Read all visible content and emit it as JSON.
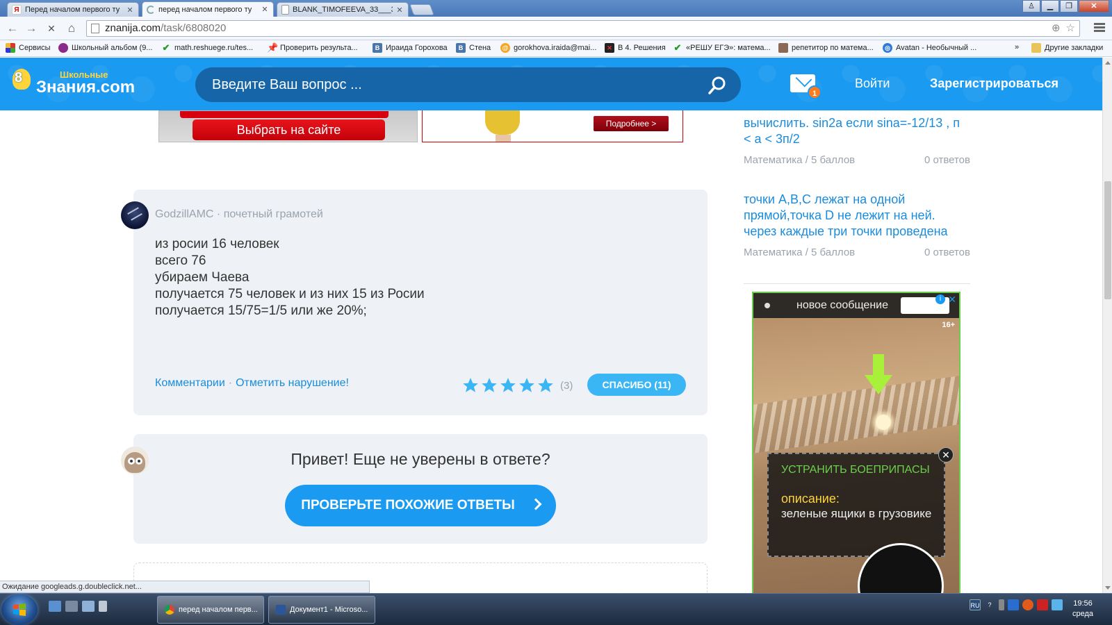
{
  "browser": {
    "tabs": [
      {
        "title": "Перед началом первого ту",
        "favicon": "Я",
        "active": false
      },
      {
        "title": "перед началом первого ту",
        "favicon": "",
        "active": true
      },
      {
        "title": "BLANK_TIMOFEEVA_33___3",
        "favicon": "",
        "active": false
      }
    ],
    "url": {
      "host": "znanija.com",
      "path": "/task/6808020"
    },
    "bookmarks": [
      {
        "label": "Сервисы",
        "icon": "apps-icon"
      },
      {
        "label": "Школьный альбом (9...",
        "icon": "eye-icon"
      },
      {
        "label": "math.reshuege.ru/tes...",
        "icon": "check-icon"
      },
      {
        "label": "Проверить результа...",
        "icon": "pin-icon"
      },
      {
        "label": "Ираида Горохова",
        "icon": "vk-icon"
      },
      {
        "label": "Стена",
        "icon": "vk-icon"
      },
      {
        "label": "gorokhova.iraida@mai...",
        "icon": "at-icon"
      },
      {
        "label": "В 4. Решения",
        "icon": "x-icon"
      },
      {
        "label": "«РЕШУ ЕГЭ»: матема...",
        "icon": "check-icon"
      },
      {
        "label": "репетитор по матема...",
        "icon": "person-icon"
      },
      {
        "label": "Avatan - Необычный ...",
        "icon": "avatan-icon"
      }
    ],
    "bookmarks_overflow": "»",
    "other_bookmarks": "Другие закладки"
  },
  "site": {
    "logo_small": "Школьные",
    "logo_big": "Знания.com",
    "search_placeholder": "Введите Ваш вопрос ...",
    "mail_badge": "1",
    "login": "Войти",
    "register": "Зарегистрироваться"
  },
  "ads": {
    "left_button": "Выбрать на сайте",
    "right_button": "Подробнее >"
  },
  "answer": {
    "author": "GodzillAMC",
    "author_rank": "почетный грамотей",
    "lines": [
      "из росии 16 человек",
      "всего 76",
      "убираем Чаева",
      "получается 75 человек и из них 15 из Росии",
      "получается 15/75=1/5 или же 20%;"
    ],
    "comments_link": "Комментарии",
    "report_link": "Отметить нарушение!",
    "rating_stars": 5,
    "rating_count": "(3)",
    "thanks_button": "СПАСИБО (11)"
  },
  "hint": {
    "title": "Привет! Еще не уверены в ответе?",
    "button": "ПРОВЕРЬТЕ ПОХОЖИЕ ОТВЕТЫ"
  },
  "sidebar": {
    "questions": [
      {
        "text_lines": [
          "вычислить. sin2a если sina=-12/13 , п",
          "< a < 3п/2"
        ],
        "subject": "Математика",
        "points": "5 баллов",
        "answers": "0 ответов"
      },
      {
        "text_lines": [
          "точки А,В,С лежат на одной",
          "прямой,точка D не лежит на ней.",
          "через каждые три точки проведена"
        ],
        "subject": "Математика",
        "points": "5 баллов",
        "answers": "0 ответов"
      }
    ],
    "meta_separator": "/"
  },
  "side_ad": {
    "top_text": "новое сообщение",
    "age": "16+",
    "info": "i",
    "close": "✕",
    "heading": "УСТРАНИТЬ БОЕПРИПАСЫ",
    "desc_label": "описание:",
    "desc_text": "зеленые ящики в грузовике",
    "panel_close": "✕"
  },
  "status_bar": "Ожидание googleads.g.doubleclick.net...",
  "taskbar": {
    "tasks": [
      {
        "label": "перед началом перв...",
        "icon": "chrome-icon",
        "active": true
      },
      {
        "label": "Документ1 - Microso...",
        "icon": "word-icon",
        "active": false
      }
    ],
    "lang": "RU",
    "time": "19:56",
    "day": "среда"
  },
  "colors": {
    "brand": "#1a9af0",
    "brand_dark": "#1565a8",
    "link": "#1a8cde",
    "card_bg": "#eef1f5",
    "thanks": "#3ab6f4",
    "badge": "#ff7a1a"
  }
}
